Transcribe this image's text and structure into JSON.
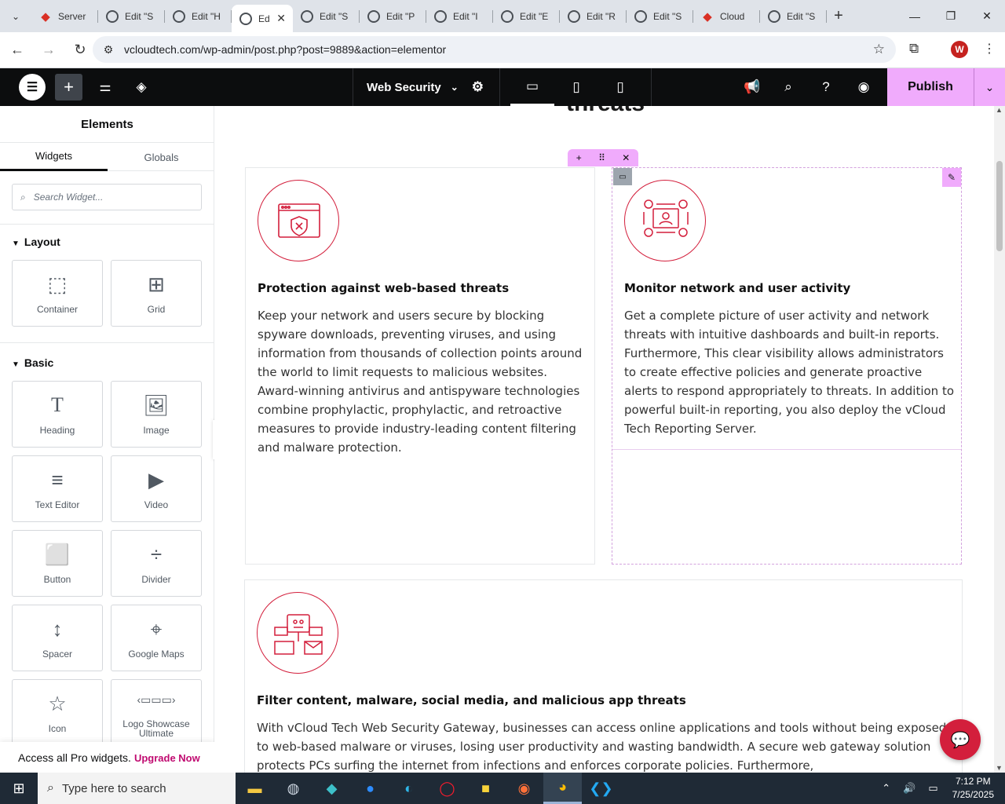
{
  "browser": {
    "tabs": [
      {
        "title": "Server",
        "icon": "red-diamond-icon",
        "active": false
      },
      {
        "title": "Edit \"S",
        "icon": "wordpress-icon",
        "active": false
      },
      {
        "title": "Edit \"H",
        "icon": "wordpress-icon",
        "active": false
      },
      {
        "title": "Ed",
        "icon": "wordpress-icon",
        "active": true
      },
      {
        "title": "Edit \"S",
        "icon": "wordpress-icon",
        "active": false
      },
      {
        "title": "Edit \"P",
        "icon": "wordpress-icon",
        "active": false
      },
      {
        "title": "Edit \"I",
        "icon": "wordpress-icon",
        "active": false
      },
      {
        "title": "Edit \"E",
        "icon": "wordpress-icon",
        "active": false
      },
      {
        "title": "Edit \"R",
        "icon": "wordpress-icon",
        "active": false
      },
      {
        "title": "Edit \"S",
        "icon": "wordpress-icon",
        "active": false
      },
      {
        "title": "Cloud",
        "icon": "red-diamond-icon",
        "active": false
      },
      {
        "title": "Edit \"S",
        "icon": "wordpress-icon",
        "active": false
      }
    ],
    "url": "vcloudtech.com/wp-admin/post.php?post=9889&action=elementor",
    "profile_initial": "W"
  },
  "editor": {
    "document_title": "Web Security",
    "publish_label": "Publish"
  },
  "panel": {
    "title": "Elements",
    "tabs": [
      "Widgets",
      "Globals"
    ],
    "search_placeholder": "Search Widget...",
    "layout_label": "Layout",
    "basic_label": "Basic",
    "layout_widgets": [
      {
        "label": "Container",
        "icon": "container-icon"
      },
      {
        "label": "Grid",
        "icon": "grid-icon"
      }
    ],
    "basic_widgets": [
      {
        "label": "Heading",
        "icon": "heading-icon"
      },
      {
        "label": "Image",
        "icon": "image-icon"
      },
      {
        "label": "Text Editor",
        "icon": "text-editor-icon"
      },
      {
        "label": "Video",
        "icon": "video-icon"
      },
      {
        "label": "Button",
        "icon": "button-icon"
      },
      {
        "label": "Divider",
        "icon": "divider-icon"
      },
      {
        "label": "Spacer",
        "icon": "spacer-icon"
      },
      {
        "label": "Google Maps",
        "icon": "map-icon"
      },
      {
        "label": "Icon",
        "icon": "star-icon"
      },
      {
        "label": "Logo Showcase Ultimate",
        "icon": "logo-showcase-icon"
      }
    ],
    "promo_text": "Access all Pro widgets.",
    "promo_link": "Upgrade Now"
  },
  "page": {
    "heading_fragment": "threats",
    "cards": [
      {
        "title": "Protection against web-based threats",
        "icon": "browser-shield-icon",
        "body": "Keep your network and users secure by blocking spyware downloads, preventing viruses, and using information from thousands of collection points around the world to limit requests to malicious websites. Award-winning antivirus and antispyware technologies combine prophylactic, prophylactic, and retroactive measures to provide industry-leading content filtering and malware protection."
      },
      {
        "title": "Monitor network and user activity",
        "icon": "network-monitor-icon",
        "body": "Get a complete picture of user activity and network threats with intuitive dashboards and built-in reports. Furthermore, This clear visibility allows administrators to create effective policies and generate proactive alerts to respond appropriately to threats. In addition to powerful built-in reporting, you also deploy the vCloud Tech Reporting Server."
      },
      {
        "title": "Filter content, malware, social media, and malicious app threats",
        "icon": "malware-filter-icon",
        "body": "With vCloud Tech Web Security Gateway, businesses can access online applications and tools without being exposed to web-based malware or viruses, losing user productivity and wasting bandwidth. A secure web gateway solution protects PCs surfing the internet from infections and enforces corporate policies. Furthermore,"
      }
    ]
  },
  "taskbar": {
    "search_placeholder": "Type here to search",
    "time": "7:12 PM",
    "date": "7/25/2025"
  },
  "colors": {
    "accent_pink": "#f0abfc",
    "brand_red": "#d31f3c",
    "editor_bar": "#0c0d0e"
  }
}
